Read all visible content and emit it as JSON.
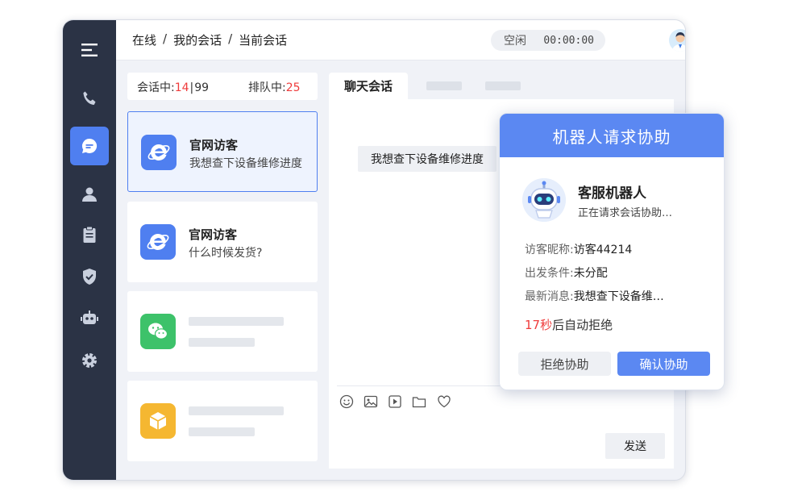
{
  "colors": {
    "accent": "#4f7ff0",
    "sidebar": "#2b3345",
    "danger": "#ef3b3b",
    "online": "#2ebd59"
  },
  "sidebar": {
    "items": [
      {
        "icon": "menu-icon"
      },
      {
        "icon": "phone-icon"
      },
      {
        "icon": "chat-bubble-icon",
        "active": true
      },
      {
        "icon": "user-icon"
      },
      {
        "icon": "clipboard-icon"
      },
      {
        "icon": "shield-check-icon"
      },
      {
        "icon": "robot-icon"
      },
      {
        "icon": "gear-icon"
      }
    ]
  },
  "header": {
    "breadcrumb": [
      "在线",
      "我的会话",
      "当前会话"
    ],
    "separator": "/",
    "status": "空闲",
    "timer": "00:00:00"
  },
  "counters": {
    "in_session_label": "会话中:",
    "in_session_value": "14",
    "in_session_max": "99",
    "queue_label": "排队中:",
    "queue_value": "25"
  },
  "conversations": [
    {
      "channel": "ie-icon",
      "title": "官网访客",
      "message": "我想查下设备维修进度",
      "selected": true
    },
    {
      "channel": "ie-icon",
      "title": "官网访客",
      "message": "什么时候发货?"
    },
    {
      "channel": "wechat-icon",
      "placeholder": true
    },
    {
      "channel": "box-app-icon",
      "placeholder": true
    }
  ],
  "chat": {
    "tab_label": "聊天会话",
    "visitor_message": "我想查下设备维修进度",
    "toolbar": [
      "emoji-icon",
      "image-icon",
      "video-icon",
      "folder-icon",
      "heart-icon"
    ],
    "send_label": "发送"
  },
  "popup": {
    "title": "机器人请求协助",
    "robot_name": "客服机器人",
    "robot_status": "正在请求会话协助…",
    "fields": [
      {
        "label": "访客昵称:",
        "value": "访客44214"
      },
      {
        "label": "出发条件:",
        "value": "未分配"
      },
      {
        "label": "最新消息:",
        "value": "我想查下设备维…"
      }
    ],
    "countdown_value": "17秒",
    "countdown_suffix": "后自动拒绝",
    "reject_label": "拒绝协助",
    "confirm_label": "确认协助"
  }
}
